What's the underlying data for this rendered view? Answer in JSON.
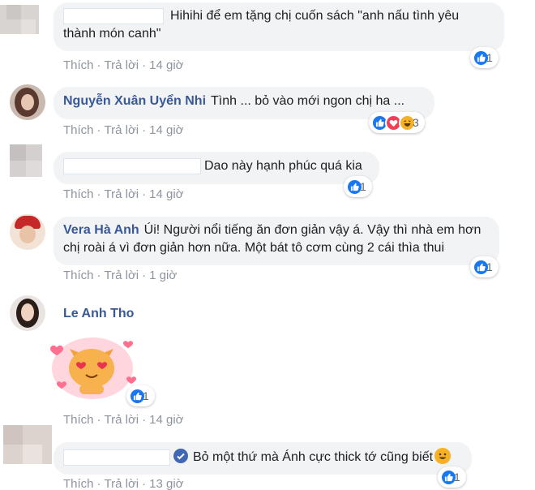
{
  "comments": [
    {
      "name": "",
      "text": "Hihihi để em tặng chị cuốn sách \"anh nấu tình yêu thành món canh\"",
      "like_label": "Thích",
      "reply_label": "Trả lời",
      "time": "14 giờ",
      "reaction_count": "1"
    },
    {
      "name": "Nguyễn Xuân Uyển Nhi",
      "text": "Tình ... bỏ vào mới ngon chị ha ...",
      "like_label": "Thích",
      "reply_label": "Trả lời",
      "time": "14 giờ",
      "reaction_count": "3"
    },
    {
      "name": "",
      "text": "Dao này hạnh phúc quá kia",
      "like_label": "Thích",
      "reply_label": "Trả lời",
      "time": "14 giờ",
      "reaction_count": "1"
    },
    {
      "name": "Vera Hà Anh",
      "text": "Úi! Người nổi tiếng ăn đơn giản vậy á. Vậy thì nhà em hơn chị roài á vì đơn giản hơn nữa. Một bát tô cơm cùng 2 cái thìa thui",
      "like_label": "Thích",
      "reply_label": "Trả lời",
      "time": "1 giờ",
      "reaction_count": "1"
    },
    {
      "name": "Le Anh Tho",
      "sticker": "cat-heart-eyes-sticker",
      "like_label": "Thích",
      "reply_label": "Trả lời",
      "time": "14 giờ",
      "reaction_count": "1"
    },
    {
      "name": "",
      "text": "Bỏ một thứ mà Ánh cực thick tớ cũng biết",
      "like_label": "Thích",
      "reply_label": "Trả lời",
      "time": "13 giờ",
      "reaction_count": "1"
    }
  ],
  "colors": {
    "bubble": "#f2f3f5",
    "name": "#385898",
    "meta": "#8d949e",
    "like": "#1877f2",
    "love": "#f33e58",
    "haha": "#f7b125"
  }
}
